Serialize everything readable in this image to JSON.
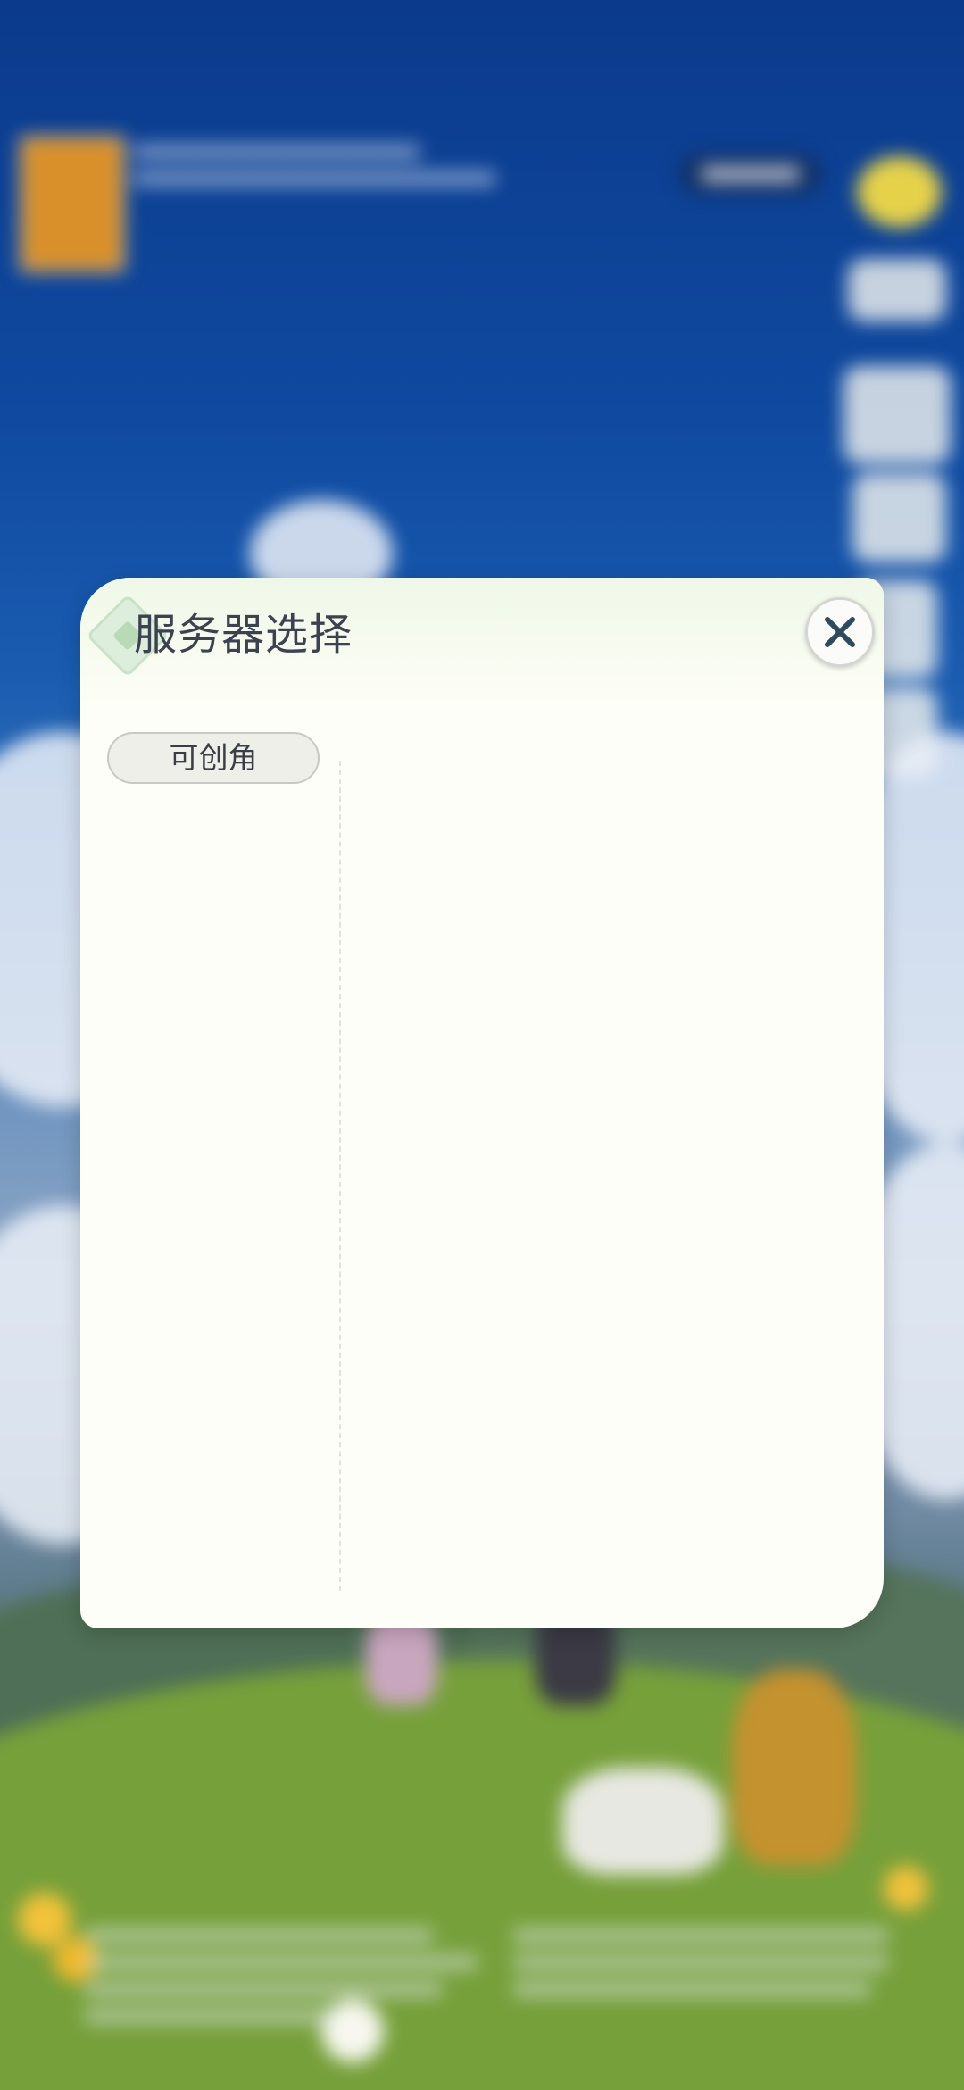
{
  "dialog": {
    "title": "服务器选择",
    "close_icon": "close-icon",
    "categories": [
      {
        "label": "可创角"
      }
    ]
  },
  "colors": {
    "dialog_bg": "#fdfef7",
    "title_text": "#3c4250",
    "background_sky": "#0f4aa0"
  }
}
